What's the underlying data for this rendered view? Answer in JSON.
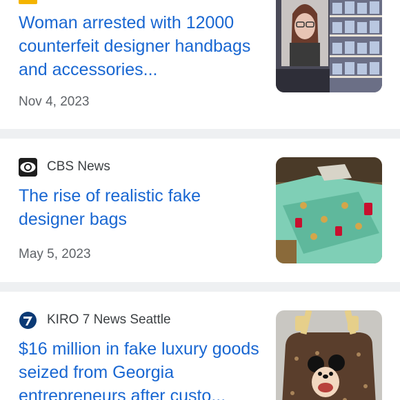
{
  "articles": [
    {
      "source": "",
      "headline": "Woman arrested with 12000 counterfeit designer handbags and accessories...",
      "date": "Nov 4, 2023",
      "icon": "news-publisher-icon"
    },
    {
      "source": "CBS News",
      "headline": "The rise of realistic fake designer bags",
      "date": "May 5, 2023",
      "icon": "cbs-eye-logo-icon"
    },
    {
      "source": "KIRO 7 News Seattle",
      "headline": "$16 million in fake luxury goods seized from Georgia entrepreneurs after custo...",
      "date": "",
      "icon": "kiro7-logo-icon"
    }
  ],
  "colors": {
    "headline": "#1967d2",
    "source_text": "#3c4043",
    "date_text": "#5f6368",
    "divider": "#eef0f2"
  }
}
